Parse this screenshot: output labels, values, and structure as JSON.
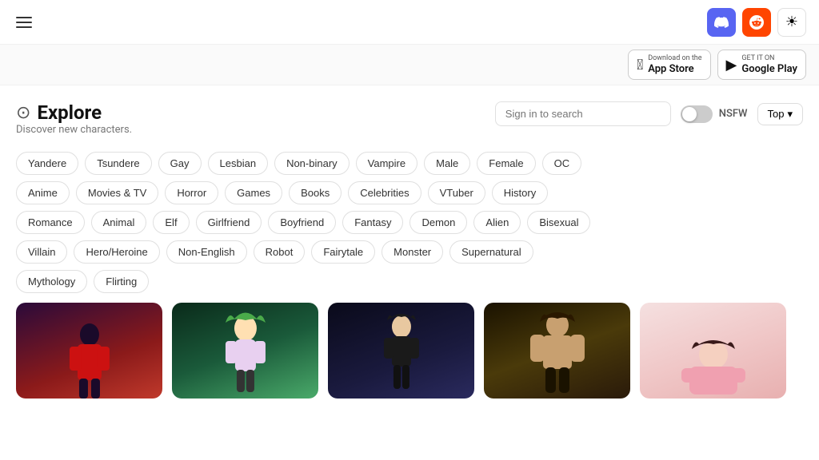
{
  "header": {
    "discord_label": "Discord",
    "reddit_label": "Reddit",
    "theme_icon": "☀"
  },
  "store_bar": {
    "app_store_small": "Download on the",
    "app_store_name": "App Store",
    "google_play_small": "GET IT ON",
    "google_play_name": "Google Play"
  },
  "explore": {
    "icon": "⊙",
    "title": "Explore",
    "subtitle": "Discover new characters.",
    "nsfw_label": "NSFW",
    "sort_label": "Top",
    "search_placeholder": "Sign in to search"
  },
  "tags": {
    "row1": [
      "Yandere",
      "Tsundere",
      "Gay",
      "Lesbian",
      "Non-binary",
      "Vampire",
      "Male",
      "Female",
      "OC"
    ],
    "row2": [
      "Anime",
      "Movies & TV",
      "Horror",
      "Games",
      "Books",
      "Celebrities",
      "VTuber",
      "History"
    ],
    "row3": [
      "Romance",
      "Animal",
      "Elf",
      "Girlfriend",
      "Boyfriend",
      "Fantasy",
      "Demon",
      "Alien",
      "Bisexual"
    ],
    "row4": [
      "Villain",
      "Hero/Heroine",
      "Non-English",
      "Robot",
      "Fairytale",
      "Monster",
      "Supernatural"
    ],
    "row5": [
      "Mythology",
      "Flirting"
    ]
  },
  "cards": [
    {
      "id": 1,
      "style": "card-1"
    },
    {
      "id": 2,
      "style": "card-2"
    },
    {
      "id": 3,
      "style": "card-3"
    },
    {
      "id": 4,
      "style": "card-4"
    },
    {
      "id": 5,
      "style": "card-5"
    }
  ]
}
